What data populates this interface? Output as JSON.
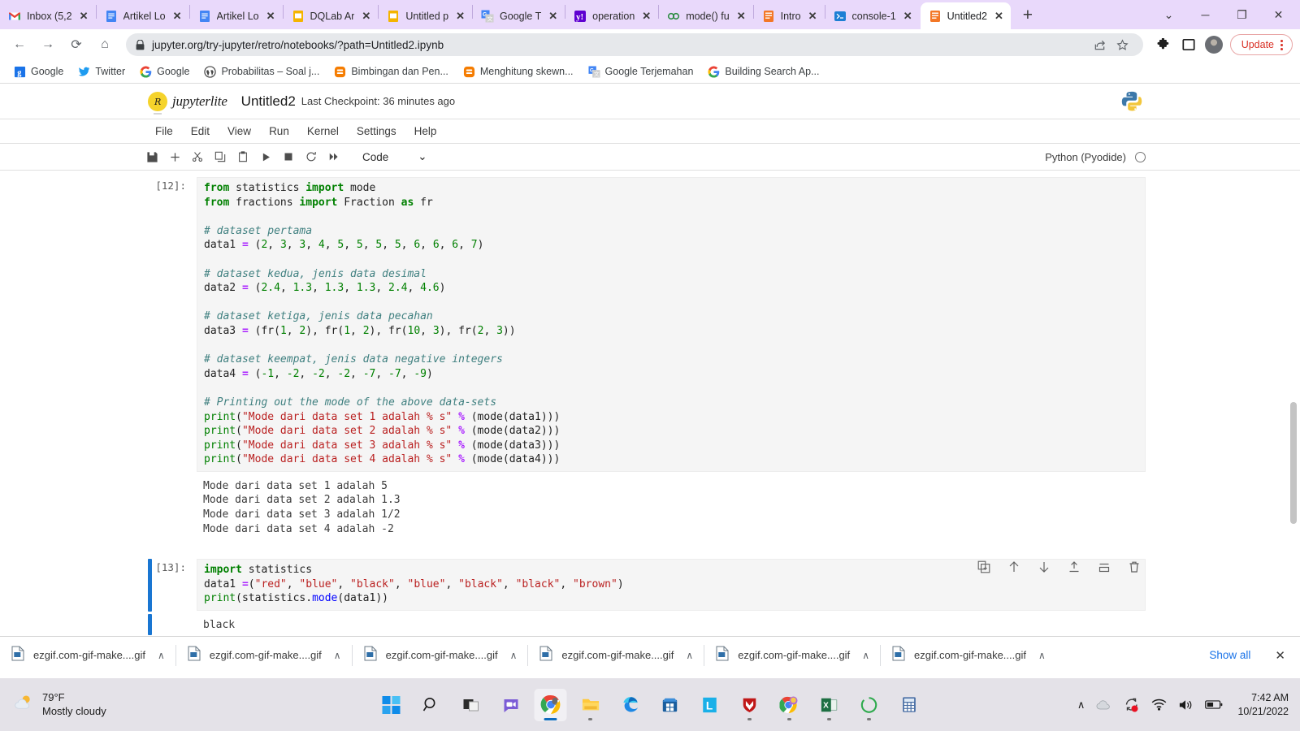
{
  "browser": {
    "tabs": [
      {
        "title": "Inbox (5,2",
        "icon": "gmail-icon",
        "active": false
      },
      {
        "title": "Artikel Lo",
        "icon": "docs-icon",
        "active": false
      },
      {
        "title": "Artikel Lo",
        "icon": "docs-icon",
        "active": false
      },
      {
        "title": "DQLab Ar",
        "icon": "slides-icon",
        "active": false
      },
      {
        "title": "Untitled p",
        "icon": "slides-icon",
        "active": false
      },
      {
        "title": "Google T",
        "icon": "translate-icon",
        "active": false
      },
      {
        "title": "operation",
        "icon": "yahoo-icon",
        "active": false
      },
      {
        "title": "mode() fu",
        "icon": "geeks-icon",
        "active": false
      },
      {
        "title": "Intro",
        "icon": "jupyter-icon",
        "active": false
      },
      {
        "title": "console-1",
        "icon": "terminal-icon",
        "active": false
      },
      {
        "title": "Untitled2",
        "icon": "jupyter-icon",
        "active": true
      }
    ],
    "new_tab_label": "+",
    "close_label": "✕",
    "window_controls": {
      "expand": "⌄",
      "minimize": "─",
      "maximize": "❐",
      "close": "✕"
    },
    "nav": {
      "back": "←",
      "forward": "→",
      "reload": "⟳",
      "home": "⌂"
    },
    "url": "jupyter.org/try-jupyter/retro/notebooks/?path=Untitled2.ipynb",
    "url_placeholder": "Search Google or type a URL",
    "update_label": "Update",
    "bookmarks": [
      {
        "label": "Google",
        "icon": "google-blue-icon"
      },
      {
        "label": "Twitter",
        "icon": "twitter-icon"
      },
      {
        "label": "Google",
        "icon": "google-g-icon"
      },
      {
        "label": "Probabilitas – Soal j...",
        "icon": "wordpress-icon"
      },
      {
        "label": "Bimbingan dan Pen...",
        "icon": "blogger-icon"
      },
      {
        "label": "Menghitung skewn...",
        "icon": "blogger-icon"
      },
      {
        "label": "Google Terjemahan",
        "icon": "translate-icon"
      },
      {
        "label": "Building Search Ap...",
        "icon": "google-g-icon"
      }
    ]
  },
  "jupyter": {
    "brand": "jupyterlite",
    "brand_mark": "𝐽̸",
    "notebook_title": "Untitled2",
    "checkpoint": "Last Checkpoint: 36 minutes ago",
    "menus": [
      "File",
      "Edit",
      "View",
      "Run",
      "Kernel",
      "Settings",
      "Help"
    ],
    "toolbar_buttons": [
      {
        "name": "save-button",
        "glyph": "💾"
      },
      {
        "name": "insert-cell-button",
        "glyph": "+"
      },
      {
        "name": "cut-button",
        "glyph": "✂"
      },
      {
        "name": "copy-button",
        "glyph": "⧉"
      },
      {
        "name": "paste-button",
        "glyph": "📋"
      },
      {
        "name": "run-button",
        "glyph": "▶"
      },
      {
        "name": "stop-button",
        "glyph": "■"
      },
      {
        "name": "restart-kernel-button",
        "glyph": "↻"
      },
      {
        "name": "restart-run-all-button",
        "glyph": "⏩"
      }
    ],
    "cell_type": "Code",
    "cell_type_caret": "⌄",
    "kernel_name": "Python (Pyodide)",
    "cell_toolbar": [
      {
        "name": "duplicate-cell-icon",
        "glyph": "⧉"
      },
      {
        "name": "move-cell-up-icon",
        "glyph": "↑"
      },
      {
        "name": "move-cell-down-icon",
        "glyph": "↓"
      },
      {
        "name": "insert-cell-above-icon",
        "glyph": "⤒"
      },
      {
        "name": "insert-cell-below-icon",
        "glyph": "⤓"
      },
      {
        "name": "delete-cell-icon",
        "glyph": "🗑"
      }
    ],
    "cells": [
      {
        "prompt": "[12]:",
        "active": false,
        "code_lines": [
          [
            {
              "t": "from ",
              "c": "k"
            },
            {
              "t": "statistics ",
              "c": ""
            },
            {
              "t": "import ",
              "c": "k"
            },
            {
              "t": "mode",
              "c": ""
            }
          ],
          [
            {
              "t": "from ",
              "c": "k"
            },
            {
              "t": "fractions ",
              "c": ""
            },
            {
              "t": "import ",
              "c": "k"
            },
            {
              "t": "Fraction ",
              "c": ""
            },
            {
              "t": "as ",
              "c": "k"
            },
            {
              "t": "fr",
              "c": ""
            }
          ],
          [],
          [
            {
              "t": "# dataset pertama",
              "c": "c"
            }
          ],
          [
            {
              "t": "data1 ",
              "c": ""
            },
            {
              "t": "=",
              "c": "o"
            },
            {
              "t": " (",
              "c": ""
            },
            {
              "t": "2",
              "c": "n"
            },
            {
              "t": ", ",
              "c": ""
            },
            {
              "t": "3",
              "c": "n"
            },
            {
              "t": ", ",
              "c": ""
            },
            {
              "t": "3",
              "c": "n"
            },
            {
              "t": ", ",
              "c": ""
            },
            {
              "t": "4",
              "c": "n"
            },
            {
              "t": ", ",
              "c": ""
            },
            {
              "t": "5",
              "c": "n"
            },
            {
              "t": ", ",
              "c": ""
            },
            {
              "t": "5",
              "c": "n"
            },
            {
              "t": ", ",
              "c": ""
            },
            {
              "t": "5",
              "c": "n"
            },
            {
              "t": ", ",
              "c": ""
            },
            {
              "t": "5",
              "c": "n"
            },
            {
              "t": ", ",
              "c": ""
            },
            {
              "t": "6",
              "c": "n"
            },
            {
              "t": ", ",
              "c": ""
            },
            {
              "t": "6",
              "c": "n"
            },
            {
              "t": ", ",
              "c": ""
            },
            {
              "t": "6",
              "c": "n"
            },
            {
              "t": ", ",
              "c": ""
            },
            {
              "t": "7",
              "c": "n"
            },
            {
              "t": ")",
              "c": ""
            }
          ],
          [],
          [
            {
              "t": "# dataset kedua, jenis data desimal",
              "c": "c"
            }
          ],
          [
            {
              "t": "data2 ",
              "c": ""
            },
            {
              "t": "=",
              "c": "o"
            },
            {
              "t": " (",
              "c": ""
            },
            {
              "t": "2.4",
              "c": "n"
            },
            {
              "t": ", ",
              "c": ""
            },
            {
              "t": "1.3",
              "c": "n"
            },
            {
              "t": ", ",
              "c": ""
            },
            {
              "t": "1.3",
              "c": "n"
            },
            {
              "t": ", ",
              "c": ""
            },
            {
              "t": "1.3",
              "c": "n"
            },
            {
              "t": ", ",
              "c": ""
            },
            {
              "t": "2.4",
              "c": "n"
            },
            {
              "t": ", ",
              "c": ""
            },
            {
              "t": "4.6",
              "c": "n"
            },
            {
              "t": ")",
              "c": ""
            }
          ],
          [],
          [
            {
              "t": "# dataset ketiga, jenis data pecahan",
              "c": "c"
            }
          ],
          [
            {
              "t": "data3 ",
              "c": ""
            },
            {
              "t": "=",
              "c": "o"
            },
            {
              "t": " (fr(",
              "c": ""
            },
            {
              "t": "1",
              "c": "n"
            },
            {
              "t": ", ",
              "c": ""
            },
            {
              "t": "2",
              "c": "n"
            },
            {
              "t": "), fr(",
              "c": ""
            },
            {
              "t": "1",
              "c": "n"
            },
            {
              "t": ", ",
              "c": ""
            },
            {
              "t": "2",
              "c": "n"
            },
            {
              "t": "), fr(",
              "c": ""
            },
            {
              "t": "10",
              "c": "n"
            },
            {
              "t": ", ",
              "c": ""
            },
            {
              "t": "3",
              "c": "n"
            },
            {
              "t": "), fr(",
              "c": ""
            },
            {
              "t": "2",
              "c": "n"
            },
            {
              "t": ", ",
              "c": ""
            },
            {
              "t": "3",
              "c": "n"
            },
            {
              "t": "))",
              "c": ""
            }
          ],
          [],
          [
            {
              "t": "# dataset keempat, jenis data negative integers",
              "c": "c"
            }
          ],
          [
            {
              "t": "data4 ",
              "c": ""
            },
            {
              "t": "=",
              "c": "o"
            },
            {
              "t": " (",
              "c": ""
            },
            {
              "t": "-1",
              "c": "n"
            },
            {
              "t": ", ",
              "c": ""
            },
            {
              "t": "-2",
              "c": "n"
            },
            {
              "t": ", ",
              "c": ""
            },
            {
              "t": "-2",
              "c": "n"
            },
            {
              "t": ", ",
              "c": ""
            },
            {
              "t": "-2",
              "c": "n"
            },
            {
              "t": ", ",
              "c": ""
            },
            {
              "t": "-7",
              "c": "n"
            },
            {
              "t": ", ",
              "c": ""
            },
            {
              "t": "-7",
              "c": "n"
            },
            {
              "t": ", ",
              "c": ""
            },
            {
              "t": "-9",
              "c": "n"
            },
            {
              "t": ")",
              "c": ""
            }
          ],
          [],
          [
            {
              "t": "# Printing out the mode of the above data-sets",
              "c": "c"
            }
          ],
          [
            {
              "t": "print",
              "c": "b"
            },
            {
              "t": "(",
              "c": ""
            },
            {
              "t": "\"Mode dari data set 1 adalah % s\"",
              "c": "s"
            },
            {
              "t": " ",
              "c": ""
            },
            {
              "t": "%",
              "c": "o"
            },
            {
              "t": " (mode(data1)))",
              "c": ""
            }
          ],
          [
            {
              "t": "print",
              "c": "b"
            },
            {
              "t": "(",
              "c": ""
            },
            {
              "t": "\"Mode dari data set 2 adalah % s\"",
              "c": "s"
            },
            {
              "t": " ",
              "c": ""
            },
            {
              "t": "%",
              "c": "o"
            },
            {
              "t": " (mode(data2)))",
              "c": ""
            }
          ],
          [
            {
              "t": "print",
              "c": "b"
            },
            {
              "t": "(",
              "c": ""
            },
            {
              "t": "\"Mode dari data set 3 adalah % s\"",
              "c": "s"
            },
            {
              "t": " ",
              "c": ""
            },
            {
              "t": "%",
              "c": "o"
            },
            {
              "t": " (mode(data3)))",
              "c": ""
            }
          ],
          [
            {
              "t": "print",
              "c": "b"
            },
            {
              "t": "(",
              "c": ""
            },
            {
              "t": "\"Mode dari data set 4 adalah % s\"",
              "c": "s"
            },
            {
              "t": " ",
              "c": ""
            },
            {
              "t": "%",
              "c": "o"
            },
            {
              "t": " (mode(data4)))",
              "c": ""
            }
          ]
        ],
        "output": "Mode dari data set 1 adalah 5\nMode dari data set 2 adalah 1.3\nMode dari data set 3 adalah 1/2\nMode dari data set 4 adalah -2"
      },
      {
        "prompt": "[13]:",
        "active": true,
        "code_lines": [
          [
            {
              "t": "import ",
              "c": "k"
            },
            {
              "t": "statistics",
              "c": ""
            }
          ],
          [
            {
              "t": "data1 ",
              "c": ""
            },
            {
              "t": "=",
              "c": "o"
            },
            {
              "t": "(",
              "c": ""
            },
            {
              "t": "\"red\"",
              "c": "s"
            },
            {
              "t": ", ",
              "c": ""
            },
            {
              "t": "\"blue\"",
              "c": "s"
            },
            {
              "t": ", ",
              "c": ""
            },
            {
              "t": "\"black\"",
              "c": "s"
            },
            {
              "t": ", ",
              "c": ""
            },
            {
              "t": "\"blue\"",
              "c": "s"
            },
            {
              "t": ", ",
              "c": ""
            },
            {
              "t": "\"black\"",
              "c": "s"
            },
            {
              "t": ", ",
              "c": ""
            },
            {
              "t": "\"black\"",
              "c": "s"
            },
            {
              "t": ", ",
              "c": ""
            },
            {
              "t": "\"brown\"",
              "c": "s"
            },
            {
              "t": ")",
              "c": ""
            }
          ],
          [
            {
              "t": "print",
              "c": "b"
            },
            {
              "t": "(statistics.",
              "c": ""
            },
            {
              "t": "mode",
              "c": "f"
            },
            {
              "t": "(data1))",
              "c": ""
            }
          ]
        ],
        "output": "black"
      }
    ]
  },
  "download_shelf": {
    "items": [
      {
        "name": "ezgif.com-gif-make....gif"
      },
      {
        "name": "ezgif.com-gif-make....gif"
      },
      {
        "name": "ezgif.com-gif-make....gif"
      },
      {
        "name": "ezgif.com-gif-make....gif"
      },
      {
        "name": "ezgif.com-gif-make....gif"
      },
      {
        "name": "ezgif.com-gif-make....gif"
      }
    ],
    "caret": "∧",
    "show_all_label": "Show all",
    "close_label": "✕"
  },
  "taskbar": {
    "weather": {
      "temperature": "79°F",
      "condition": "Mostly cloudy"
    },
    "apps": [
      {
        "name": "start-button",
        "icon": "windows-icon"
      },
      {
        "name": "search-button",
        "icon": "search-icon"
      },
      {
        "name": "task-view-button",
        "icon": "task-view-icon"
      },
      {
        "name": "chat-button",
        "icon": "chat-icon"
      },
      {
        "name": "chrome-button",
        "icon": "chrome-icon",
        "active": true
      },
      {
        "name": "file-explorer-button",
        "icon": "folder-icon"
      },
      {
        "name": "edge-button",
        "icon": "edge-icon"
      },
      {
        "name": "microsoft-store-button",
        "icon": "store-icon"
      },
      {
        "name": "app-l-button",
        "icon": "letter-l-icon"
      },
      {
        "name": "mcafee-button",
        "icon": "shield-icon"
      },
      {
        "name": "chrome-2-button",
        "icon": "chrome-search-icon"
      },
      {
        "name": "excel-button",
        "icon": "excel-icon"
      },
      {
        "name": "loading-button",
        "icon": "spinner-icon"
      },
      {
        "name": "calculator-button",
        "icon": "calculator-icon"
      }
    ],
    "tray": {
      "chevron": "∧",
      "icons": [
        "cloud-icon",
        "sync-alert-icon",
        "wifi-icon",
        "volume-icon",
        "battery-icon"
      ]
    },
    "time": "7:42 AM",
    "date": "10/21/2022"
  }
}
